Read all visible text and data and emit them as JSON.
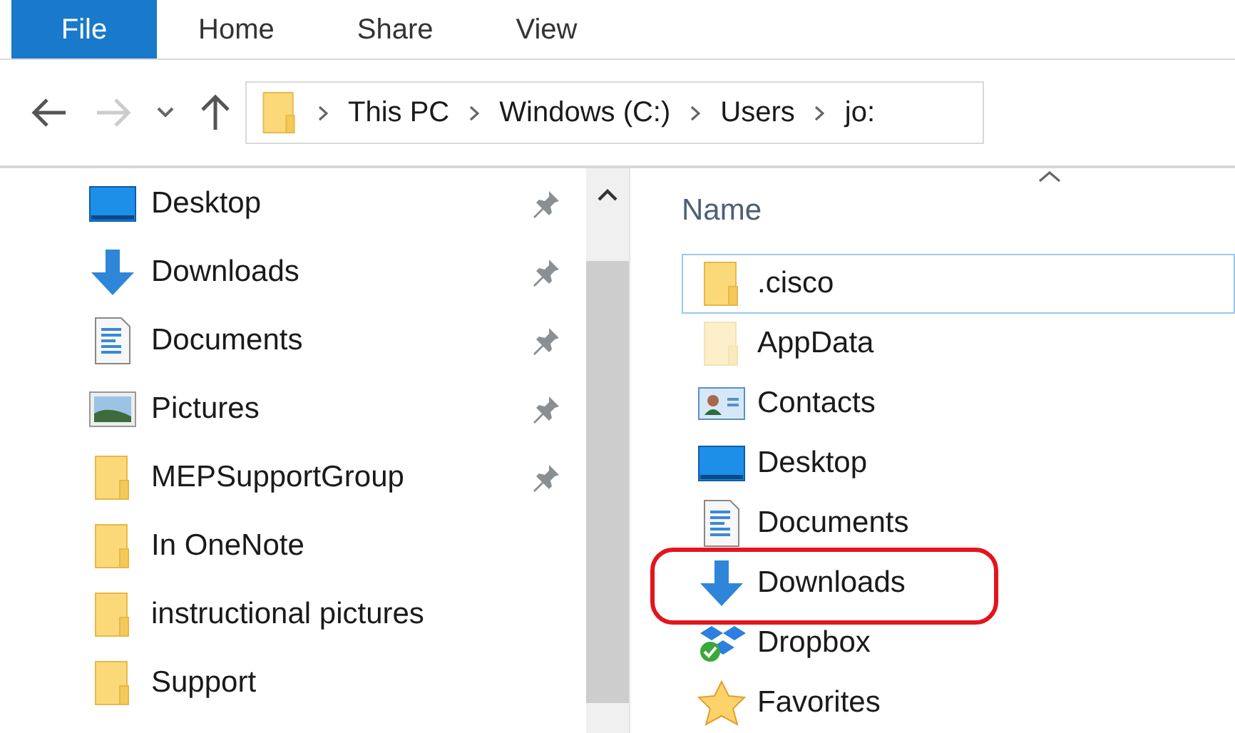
{
  "ribbon_tabs": [
    {
      "label": "File",
      "selected": true
    },
    {
      "label": "Home",
      "selected": false
    },
    {
      "label": "Share",
      "selected": false
    },
    {
      "label": "View",
      "selected": false
    }
  ],
  "address_bar": {
    "crumbs": [
      "This PC",
      "Windows (C:)",
      "Users",
      "jo:"
    ]
  },
  "navigation_pane": {
    "items": [
      {
        "label": "Desktop",
        "kind": "desktop",
        "pinned": true
      },
      {
        "label": "Downloads",
        "kind": "download",
        "pinned": true
      },
      {
        "label": "Documents",
        "kind": "document",
        "pinned": true
      },
      {
        "label": "Pictures",
        "kind": "picture",
        "pinned": true
      },
      {
        "label": "MEPSupportGroup",
        "kind": "folder",
        "pinned": true
      },
      {
        "label": "In OneNote",
        "kind": "folder",
        "pinned": false
      },
      {
        "label": "instructional pictures",
        "kind": "folder",
        "pinned": false
      },
      {
        "label": "Support",
        "kind": "folder",
        "pinned": false
      }
    ]
  },
  "file_list": {
    "columns": [
      "Name"
    ],
    "rows": [
      {
        "name": ".cisco",
        "kind": "folder",
        "selected": true,
        "hidden": false,
        "circled": false
      },
      {
        "name": "AppData",
        "kind": "folder",
        "selected": false,
        "hidden": true,
        "circled": false
      },
      {
        "name": "Contacts",
        "kind": "contact",
        "selected": false,
        "hidden": false,
        "circled": false
      },
      {
        "name": "Desktop",
        "kind": "desktop",
        "selected": false,
        "hidden": false,
        "circled": false
      },
      {
        "name": "Documents",
        "kind": "document",
        "selected": false,
        "hidden": false,
        "circled": false
      },
      {
        "name": "Downloads",
        "kind": "download",
        "selected": false,
        "hidden": false,
        "circled": true
      },
      {
        "name": "Dropbox",
        "kind": "dropbox",
        "selected": false,
        "hidden": false,
        "circled": false
      },
      {
        "name": "Favorites",
        "kind": "star",
        "selected": false,
        "hidden": false,
        "circled": false
      }
    ]
  }
}
